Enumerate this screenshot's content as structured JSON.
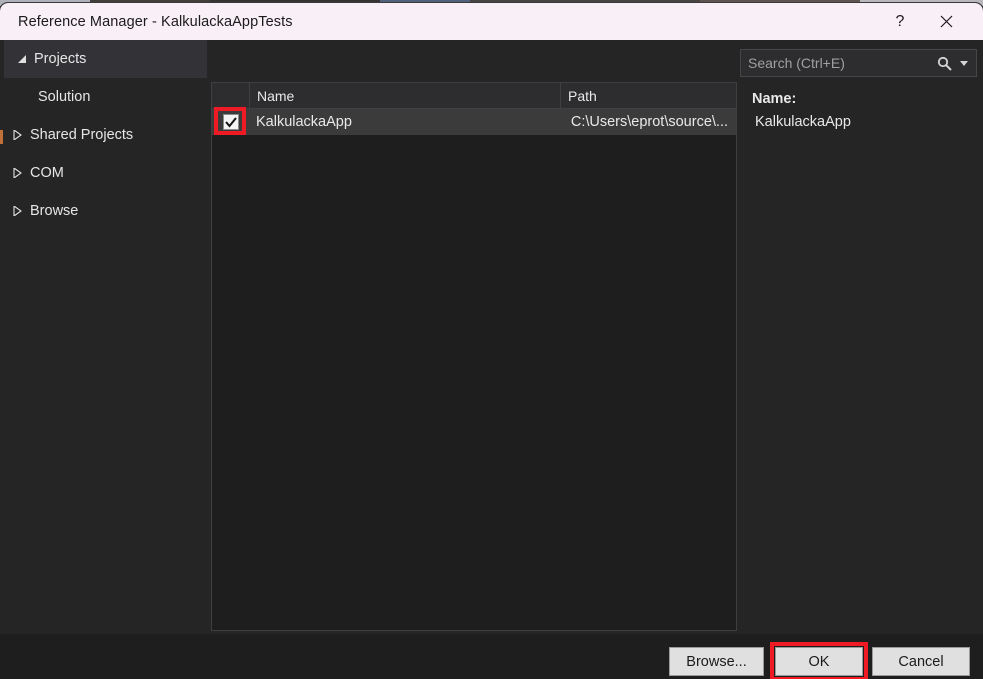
{
  "window": {
    "title": "Reference Manager - KalkulackaAppTests",
    "help_icon": "question-mark-icon",
    "close_icon": "close-icon",
    "help_label": "?",
    "close_label": "✕",
    "titlebar_color": "#f9eff6",
    "accent_highlight_color": "#ee1b24"
  },
  "sidebar": {
    "items": [
      {
        "label": "Projects",
        "expander": "triangle-down",
        "selected": true,
        "child": false
      },
      {
        "label": "Solution",
        "expander": "none",
        "selected": false,
        "child": true
      },
      {
        "label": "Shared Projects",
        "expander": "triangle-right",
        "selected": false,
        "child": false
      },
      {
        "label": "COM",
        "expander": "triangle-right",
        "selected": false,
        "child": false
      },
      {
        "label": "Browse",
        "expander": "triangle-right",
        "selected": false,
        "child": false
      }
    ]
  },
  "search": {
    "placeholder": "Search (Ctrl+E)",
    "value": "",
    "icon": "search-icon",
    "caret_icon": "chevron-down-icon"
  },
  "list": {
    "columns": [
      "",
      "Name",
      "Path"
    ],
    "rows": [
      {
        "checked": true,
        "name": "KalkulackaApp",
        "path": "C:\\Users\\eprot\\source\\...",
        "selected": true
      }
    ]
  },
  "details": {
    "name_label": "Name:",
    "name_value": "KalkulackaApp"
  },
  "footer": {
    "browse_label": "Browse...",
    "ok_label": "OK",
    "cancel_label": "Cancel"
  }
}
